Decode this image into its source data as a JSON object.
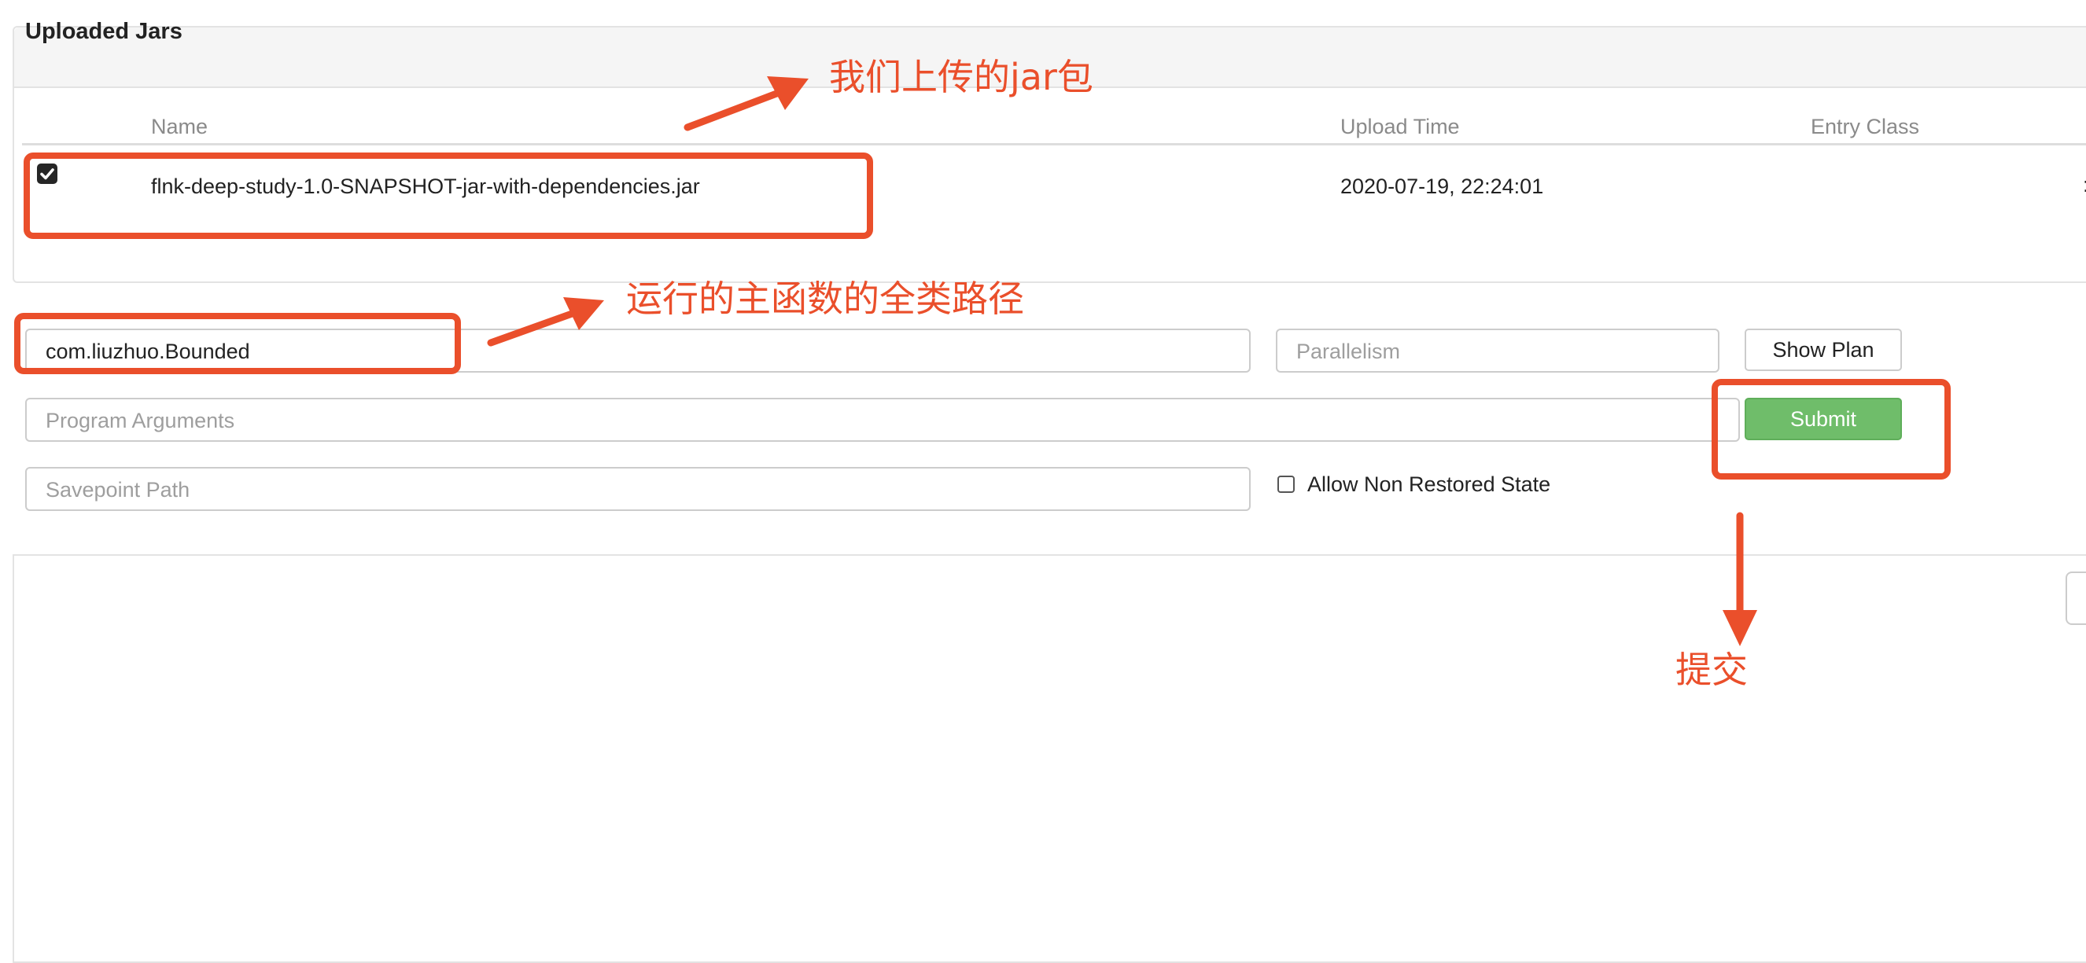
{
  "panel": {
    "title": "Uploaded Jars",
    "columns": {
      "name": "Name",
      "upload_time": "Upload Time",
      "entry_class": "Entry Class"
    },
    "rows": [
      {
        "checked": true,
        "name": "flnk-deep-study-1.0-SNAPSHOT-jar-with-dependencies.jar",
        "upload_time": "2020-07-19, 22:24:01",
        "entry_class_partial": ":"
      }
    ]
  },
  "form": {
    "entry_class_value": "com.liuzhuo.Bounded",
    "parallelism_placeholder": "Parallelism",
    "program_args_placeholder": "Program Arguments",
    "savepoint_placeholder": "Savepoint Path",
    "allow_non_restored_label": "Allow Non Restored State",
    "allow_non_restored_checked": false,
    "show_plan_label": "Show Plan",
    "submit_label": "Submit"
  },
  "annotations": {
    "jar_note": "我们上传的jar包",
    "entry_note": "运行的主函数的全类路径",
    "submit_note": "提交",
    "color": "#ea4f2b"
  },
  "colors": {
    "submit_bg": "#6fbd6a",
    "panel_header_bg": "#f5f5f5",
    "border": "#cccccc"
  },
  "icons": {
    "row_checkbox": "checkbox-checked-icon",
    "allow_checkbox": "checkbox-unchecked-icon",
    "arrows": "arrow-icon"
  }
}
